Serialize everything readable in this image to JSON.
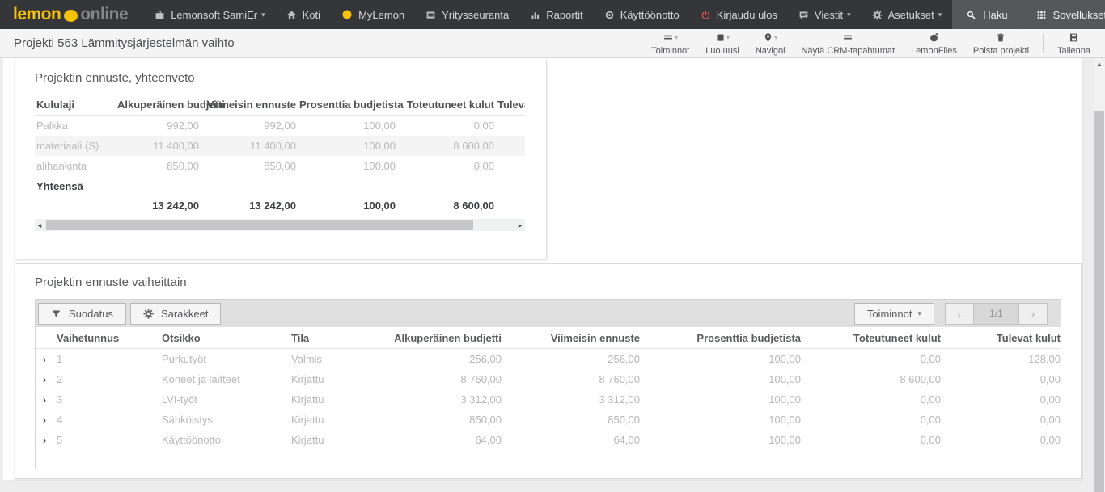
{
  "colors": {
    "brand_yellow": "#f7c200",
    "navbar_bg": "#353639",
    "appblock_bg": "#55575b",
    "logout_red": "#d05c5c",
    "toolbar_bg": "#f4f4f4",
    "page_bg": "#ededee"
  },
  "navbar": {
    "logo_lemon": "lemon",
    "logo_online": "online",
    "items": [
      {
        "label": "Lemonsoft SamiEr",
        "icon": "briefcase-icon",
        "caret": true
      },
      {
        "label": "Koti",
        "icon": "home-icon"
      },
      {
        "label": "MyLemon",
        "icon": "lemon-circle-icon"
      },
      {
        "label": "Yritysseuranta",
        "icon": "report-window-icon"
      },
      {
        "label": "Raportit",
        "icon": "bar-chart-icon"
      },
      {
        "label": "Käyttöönotto",
        "icon": "target-icon"
      }
    ],
    "right_items": [
      {
        "label": "Kirjaudu ulos",
        "icon": "power-icon"
      },
      {
        "label": "Viestit",
        "icon": "message-icon",
        "caret": true
      },
      {
        "label": "Asetukset",
        "icon": "gear-icon",
        "caret": true
      }
    ],
    "app_items": [
      {
        "label": "Haku",
        "icon": "search-icon"
      },
      {
        "label": "Sovellukset",
        "icon": "grid-icon"
      }
    ]
  },
  "toolbar": {
    "title": "Projekti 563 Lämmitysjärjestelmän vaihto",
    "buttons": [
      {
        "label": "Toiminnot",
        "icon": "menu-icon",
        "caret": true
      },
      {
        "label": "Luo uusi",
        "icon": "cube-icon",
        "caret": true
      },
      {
        "label": "Navigoi",
        "icon": "map-pin-icon",
        "caret": true
      },
      {
        "label": "Näytä CRM-tapahtumat",
        "icon": "list-icon"
      },
      {
        "label": "LemonFiles",
        "icon": "lemon-files-icon"
      },
      {
        "label": "Poista projekti",
        "icon": "trash-icon"
      },
      {
        "label": "Tallenna",
        "icon": "save-icon"
      }
    ]
  },
  "summary_panel": {
    "title": "Projektin ennuste, yhteenveto",
    "columns": [
      "Kululaji",
      "Alkuperäinen budjetti",
      "Viimeisin ennuste",
      "Prosenttia budjetista",
      "Toteutuneet kulut",
      "Tulevat kulut"
    ],
    "rows": [
      [
        "Palkka",
        "992,00",
        "992,00",
        "100,00",
        "0,00"
      ],
      [
        "materiaali (S)",
        "11 400,00",
        "11 400,00",
        "100,00",
        "8 600,00"
      ],
      [
        "alihankinta",
        "850,00",
        "850,00",
        "100,00",
        "0,00"
      ]
    ],
    "total_label": "Yhteensä",
    "totals": [
      "13 242,00",
      "13 242,00",
      "100,00",
      "8 600,00"
    ]
  },
  "phases_panel": {
    "title": "Projektin ennuste vaiheittain",
    "toolbar": {
      "filter_label": "Suodatus",
      "columns_label": "Sarakkeet",
      "actions_label": "Toiminnot",
      "page_indicator": "1/1"
    },
    "columns": [
      "Vaihetunnus",
      "Otsikko",
      "Tila",
      "Alkuperäinen budjetti",
      "Viimeisin ennuste",
      "Prosenttia budjetista",
      "Toteutuneet kulut",
      "Tulevat kulut"
    ],
    "rows": [
      [
        "1",
        "Purkutyöt",
        "Valmis",
        "256,00",
        "256,00",
        "100,00",
        "0,00",
        "128,00"
      ],
      [
        "2",
        "Koneet ja laitteet",
        "Kirjattu",
        "8 760,00",
        "8 760,00",
        "100,00",
        "8 600,00",
        "0,00"
      ],
      [
        "3",
        "LVI-työt",
        "Kirjattu",
        "3 312,00",
        "3 312,00",
        "100,00",
        "0,00",
        "0,00"
      ],
      [
        "4",
        "Sähköistys",
        "Kirjattu",
        "850,00",
        "850,00",
        "100,00",
        "0,00",
        "0,00"
      ],
      [
        "5",
        "Käyttöönotto",
        "Kirjattu",
        "64,00",
        "64,00",
        "100,00",
        "0,00",
        "0,00"
      ]
    ]
  }
}
